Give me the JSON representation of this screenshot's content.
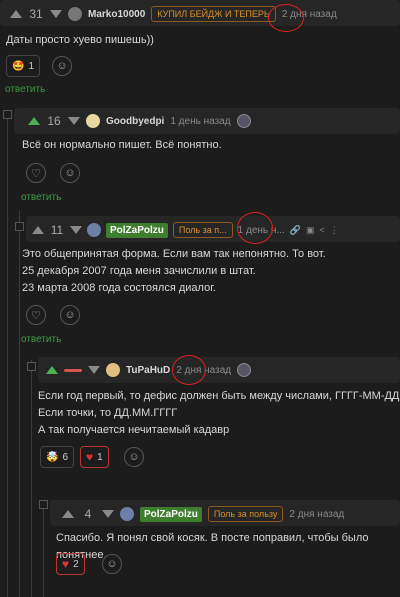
{
  "c1": {
    "score": "31",
    "user": "Marko10000",
    "pill": "КУПИЛ БЕЙДЖ И ТЕПЕРЬ",
    "time": "2 дня назад",
    "text": "Даты просто хуево пишешь))",
    "reaction_count": "1",
    "reply": "ответить"
  },
  "c2": {
    "score": "16",
    "user": "Goodbyedpi",
    "time": "1 день назад",
    "text": "Всё он нормально пишет. Всё понятно.",
    "reply": "ответить"
  },
  "c3": {
    "score": "11",
    "user": "PolZaPolzu",
    "pill": "Поль за п...",
    "time": "1 день н...",
    "lines": [
      "Это общепринятая форма. Если вам так непонятно. То вот.",
      "25 декабря 2007 года меня зачислили в штат.",
      "23 марта 2008 года состоялся диалог."
    ],
    "reply": "ответить"
  },
  "c4": {
    "user": "TuPaHuD",
    "time": "2 дня назад",
    "lines": [
      "Если год первый, то дефис должен быть между числами, ГГГГ-ММ-ДД",
      "Если точки, то ДД.ММ.ГГГГ",
      "А так получается нечитаемый кадавр"
    ],
    "reaction_count": "6",
    "likes": "1"
  },
  "c5": {
    "score": "4",
    "user": "PolZaPolzu",
    "pill": "Поль за пользу",
    "time": "2 дня назад",
    "text": "Спасибо. Я понял свой косяк. В посте поправил, чтобы было понятнее.",
    "likes": "2"
  },
  "colors": {
    "green": "#4caf50",
    "badge": "#3f7e2f",
    "accent": "#d8902e",
    "red": "#d33333",
    "background": "#1c1c1c"
  },
  "icons": [
    "arrow-up-icon",
    "arrow-down-icon",
    "heart-icon",
    "emoji-add-icon",
    "bookmark-icon",
    "share-icon",
    "more-icon"
  ]
}
